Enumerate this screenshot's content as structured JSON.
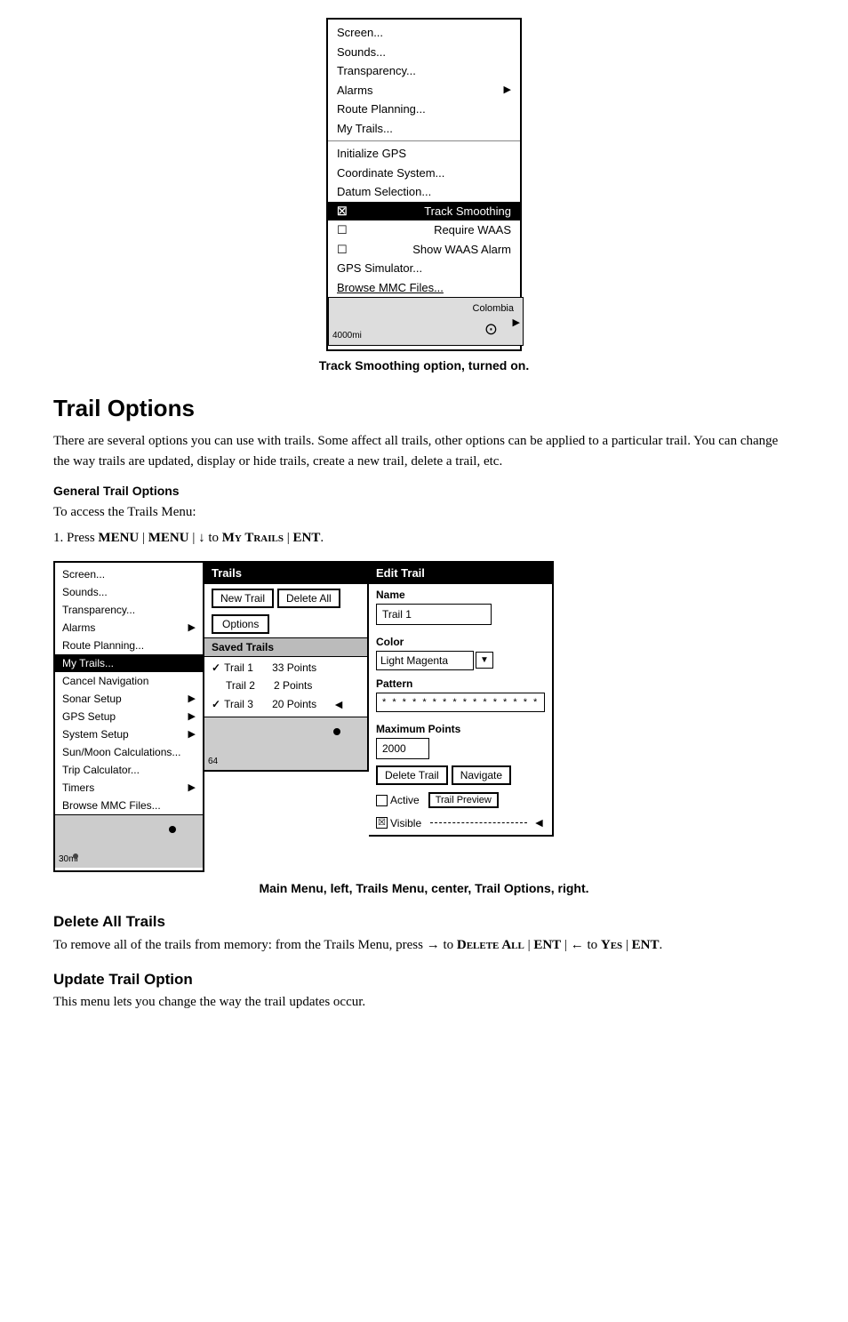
{
  "top_menu": {
    "items": [
      {
        "label": "Screen...",
        "type": "normal"
      },
      {
        "label": "Sounds...",
        "type": "normal"
      },
      {
        "label": "Transparency...",
        "type": "normal"
      },
      {
        "label": "Alarms",
        "type": "arrow"
      },
      {
        "label": "Route Planning...",
        "type": "normal"
      },
      {
        "label": "My Trails...",
        "type": "normal"
      }
    ],
    "divider_items": [
      {
        "label": "Initialize GPS",
        "type": "normal"
      },
      {
        "label": "Coordinate System...",
        "type": "normal"
      },
      {
        "label": "Datum Selection...",
        "type": "normal"
      },
      {
        "label": "Track Smoothing",
        "type": "checked",
        "checked": true
      },
      {
        "label": "Require WAAS",
        "type": "checkbox",
        "checked": false
      },
      {
        "label": "Show WAAS Alarm",
        "type": "checkbox",
        "checked": false
      },
      {
        "label": "GPS Simulator...",
        "type": "normal"
      },
      {
        "label": "Browse MMC Files...",
        "type": "normal",
        "underline": true
      }
    ],
    "map": {
      "colombia_label": "Colombia",
      "distance_label": "4000mi"
    }
  },
  "top_caption": "Track Smoothing option, turned on.",
  "section_title": "Trail Options",
  "body_text": "There are several options you can use with trails. Some affect all trails, other options can be applied to a particular trail. You can change the way trails are updated, display or hide trails, create a new trail, delete a trail, etc.",
  "general_title": "General Trail Options",
  "step1_prefix": "To access the Trails Menu:",
  "step1": "1. Press ",
  "step1_bold1": "MENU",
  "step1_sep1": " | ",
  "step1_bold2": "MENU",
  "step1_sep2": " | ↓ to ",
  "step1_bold3": "My Trails",
  "step1_sep3": " | ",
  "step1_bold4": "ENT",
  "step1_end": ".",
  "left_panel": {
    "title": "Main Menu",
    "items": [
      {
        "label": "Screen...",
        "highlighted": false
      },
      {
        "label": "Sounds...",
        "highlighted": false
      },
      {
        "label": "Transparency...",
        "highlighted": false
      },
      {
        "label": "Alarms",
        "highlighted": false,
        "arrow": true
      },
      {
        "label": "Route Planning...",
        "highlighted": false
      },
      {
        "label": "My Trails...",
        "highlighted": true
      },
      {
        "label": "Cancel Navigation",
        "highlighted": false
      },
      {
        "label": "Sonar Setup",
        "highlighted": false,
        "arrow": true
      },
      {
        "label": "GPS Setup",
        "highlighted": false,
        "arrow": true
      },
      {
        "label": "System Setup",
        "highlighted": false,
        "arrow": true
      },
      {
        "label": "Sun/Moon Calculations...",
        "highlighted": false
      },
      {
        "label": "Trip Calculator...",
        "highlighted": false
      },
      {
        "label": "Timers",
        "highlighted": false,
        "arrow": true
      },
      {
        "label": "Browse MMC Files...",
        "highlighted": false
      }
    ],
    "map": {
      "distance_label": "30mi"
    }
  },
  "center_panel": {
    "title": "Trails",
    "new_trail_btn": "New Trail",
    "delete_all_btn": "Delete All",
    "options_btn": "Options",
    "saved_trails_header": "Saved Trails",
    "trails": [
      {
        "check": "✓",
        "name": "Trail 1",
        "points": "33 Points",
        "selected": true
      },
      {
        "check": "",
        "name": "Trail 2",
        "points": "2 Points",
        "selected": false
      },
      {
        "check": "✓",
        "name": "Trail 3",
        "points": "20 Points",
        "selected": false,
        "arrow": true
      }
    ],
    "map": {
      "distance_label": "64"
    }
  },
  "right_panel": {
    "title": "Edit Trail",
    "name_label": "Name",
    "name_value": "Trail 1",
    "color_label": "Color",
    "color_value": "Light Magenta",
    "pattern_label": "Pattern",
    "pattern_value": "* * * * * * * * * * * * * * * *",
    "max_points_label": "Maximum Points",
    "max_points_value": "2000",
    "delete_btn": "Delete Trail",
    "navigate_btn": "Navigate",
    "active_label": "Active",
    "active_checked": false,
    "visible_label": "Visible",
    "visible_checked": true,
    "trail_preview_btn": "Trail Preview"
  },
  "bottom_caption": "Main Menu, left, Trails Menu, center, Trail Options, right.",
  "delete_all_title": "Delete All Trails",
  "delete_all_text": "To remove all of the trails from memory: from the Trails Menu, press → to ",
  "delete_all_bold1": "Delete All",
  "delete_all_sep1": " | ",
  "delete_all_bold2": "ENT",
  "delete_all_sep2": " | ← to ",
  "delete_all_bold3": "Yes",
  "delete_all_sep3": " | ",
  "delete_all_bold4": "ENT",
  "delete_all_end": ".",
  "update_title": "Update Trail Option",
  "update_text": "This menu lets you change the way the trail updates occur."
}
